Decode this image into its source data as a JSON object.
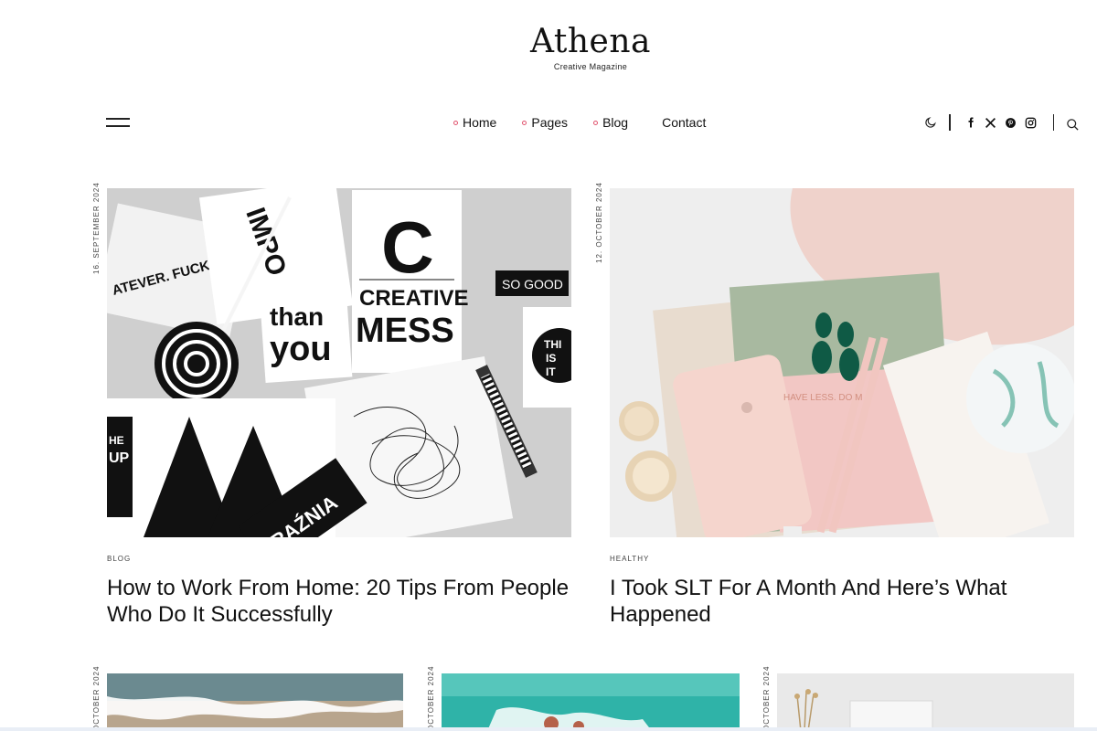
{
  "site": {
    "title": "Athena",
    "subtitle": "Creative Magazine"
  },
  "nav": {
    "items": [
      {
        "label": "Home"
      },
      {
        "label": "Pages"
      },
      {
        "label": "Blog"
      },
      {
        "label": "Contact"
      }
    ]
  },
  "tools": {
    "icons": [
      "moon-icon",
      "facebook-icon",
      "x-icon",
      "pinterest-icon",
      "instagram-icon",
      "search-icon"
    ]
  },
  "posts": [
    {
      "date": "16. SEPTEMBER 2024",
      "category": "BLOG",
      "title": "How to Work From Home: 20 Tips From People Who Do It Successfully"
    },
    {
      "date": "12. OCTOBER 2024",
      "category": "HEALTHY",
      "title": "I Took SLT For A Month And Here’s What Happened"
    }
  ],
  "bottom_posts": [
    {
      "date": "OCTOBER 2024"
    },
    {
      "date": "OCTOBER 2024"
    },
    {
      "date": "OCTOBER 2024"
    }
  ],
  "colors": {
    "accent": "#e0526d",
    "text": "#111111"
  }
}
